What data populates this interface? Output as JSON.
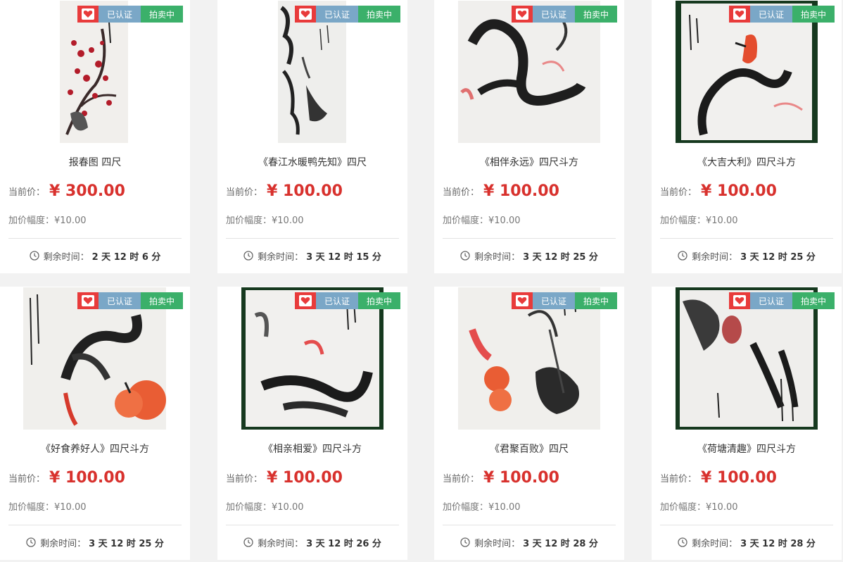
{
  "labels": {
    "certified": "已认证",
    "auctioning": "拍卖中",
    "price_label": "当前价：",
    "increment_label": "加价幅度：",
    "time_label": "剩余时间："
  },
  "items": [
    {
      "title": "报春图 四尺",
      "price": "¥ 300.00",
      "increment": "¥10.00",
      "time_left": "2 天 12 时 6 分"
    },
    {
      "title": "《春江水暖鸭先知》四尺",
      "price": "¥ 100.00",
      "increment": "¥10.00",
      "time_left": "3 天 12 时 15 分"
    },
    {
      "title": "《相伴永远》四尺斗方",
      "price": "¥ 100.00",
      "increment": "¥10.00",
      "time_left": "3 天 12 时 25 分"
    },
    {
      "title": "《大吉大利》四尺斗方",
      "price": "¥ 100.00",
      "increment": "¥10.00",
      "time_left": "3 天 12 时 25 分"
    },
    {
      "title": "《好食养好人》四尺斗方",
      "price": "¥ 100.00",
      "increment": "¥10.00",
      "time_left": "3 天 12 时 25 分"
    },
    {
      "title": "《相亲相爱》四尺斗方",
      "price": "¥ 100.00",
      "increment": "¥10.00",
      "time_left": "3 天 12 时 26 分"
    },
    {
      "title": "《君聚百败》四尺",
      "price": "¥ 100.00",
      "increment": "¥10.00",
      "time_left": "3 天 12 时 28 分"
    },
    {
      "title": "《荷塘清趣》四尺斗方",
      "price": "¥ 100.00",
      "increment": "¥10.00",
      "time_left": "3 天 12 时 28 分"
    }
  ],
  "colors": {
    "price": "#d8312d",
    "heart_badge": "#e83b3b",
    "certified_badge": "#7aa7c7",
    "auction_badge": "#3bb06a"
  },
  "icons": {
    "badge": "heart-icon",
    "time": "clock-icon"
  }
}
